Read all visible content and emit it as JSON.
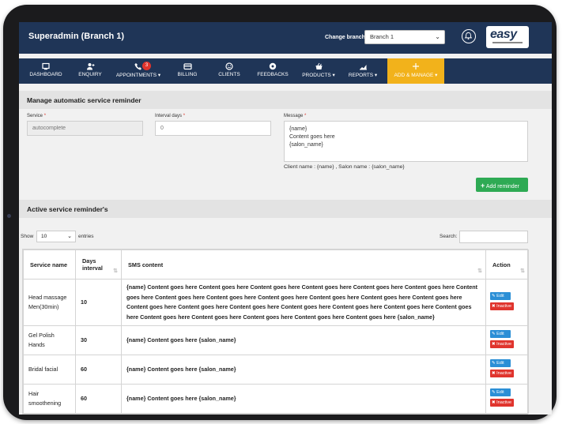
{
  "header": {
    "title": "Superadmin (Branch 1)",
    "change_branch_label": "Change branch :",
    "branch_selected": "Branch 1",
    "logo_text": "easy"
  },
  "nav": {
    "items": [
      {
        "label": "DASHBOARD"
      },
      {
        "label": "ENQUIRY"
      },
      {
        "label": "APPOINTMENTS ▾",
        "badge": "3"
      },
      {
        "label": "BILLING"
      },
      {
        "label": "CLIENTS"
      },
      {
        "label": "FEEDBACKS"
      },
      {
        "label": "PRODUCTS ▾"
      },
      {
        "label": "REPORTS ▾"
      },
      {
        "label": "ADD & MANAGE ▾"
      }
    ],
    "active_color": "#f2b21b"
  },
  "manage": {
    "title": "Manage automatic service reminder",
    "service_label": "Service",
    "service_placeholder": "autocomplete",
    "interval_label": "Interval days",
    "interval_value": "0",
    "message_label": "Message",
    "message_lines": [
      "{name}",
      "Content goes here",
      "{salon_name}"
    ],
    "hint": "Client name : {name} , Salon name : {salon_name}",
    "add_button": "Add reminder"
  },
  "active": {
    "title": "Active service reminder's",
    "show_label": "Show",
    "show_value": "10",
    "entries_label": "entries",
    "search_label": "Search:",
    "columns": [
      "Service name",
      "Days interval",
      "SMS content",
      "Action"
    ],
    "rows": [
      {
        "service": "Head massage Men(30min)",
        "days": "10",
        "sms": "{name} Content goes here Content goes here Content goes here Content goes here Content goes here Content goes here Content goes here Content goes here Content goes here Content goes here Content goes here Content goes here Content goes here Content goes here Content goes here Content goes here Content goes here Content goes here Content goes here Content goes here Content goes here Content goes here Content goes here Content goes here Content goes here {salon_name}"
      },
      {
        "service": "Gel Polish Hands",
        "days": "30",
        "sms": "{name} Content goes here {salon_name}"
      },
      {
        "service": "Bridal facial",
        "days": "60",
        "sms": "{name} Content goes here {salon_name}"
      },
      {
        "service": "Hair smoothening",
        "days": "60",
        "sms": "{name} Content goes here {salon_name}"
      }
    ],
    "edit_label": "Edit",
    "inactive_label": "Inactive"
  },
  "colors": {
    "header_bg": "#1f3557",
    "accent": "#f2b21b",
    "add_button": "#2eaa54",
    "edit_button": "#2b8fd6",
    "inactive_button": "#e0342d"
  }
}
